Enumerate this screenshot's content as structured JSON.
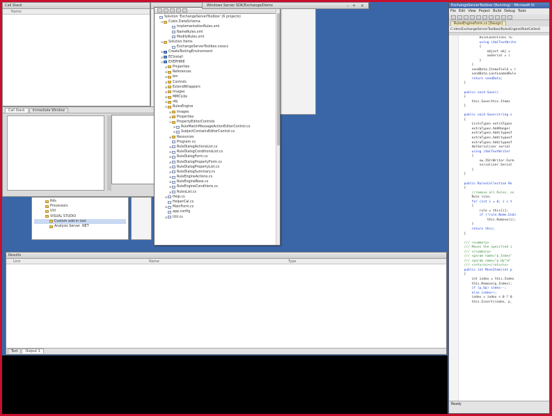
{
  "left_top_panel": {
    "title": "Call Stack",
    "header": "Name"
  },
  "left_mid_panel": {
    "tabs": [
      "Call Stack",
      "Immediate Window"
    ]
  },
  "object_tree": {
    "items": [
      {
        "label": "Rds",
        "indent": 2,
        "kind": "folder"
      },
      {
        "label": "Processors",
        "indent": 2,
        "kind": "folder"
      },
      {
        "label": "Util",
        "indent": 2,
        "kind": "folder"
      },
      {
        "label": "VISUAL STUDIO",
        "indent": 2,
        "kind": "folder"
      },
      {
        "label": "Custom add-in tool",
        "indent": 3,
        "kind": "folder",
        "selected": true
      },
      {
        "label": "Analysis Server .NET",
        "indent": 3,
        "kind": "folder"
      }
    ]
  },
  "solution_explorer": {
    "window_title": "Windows Server SDK/Exchange/Demo",
    "root": "Solution 'ExchangeServerToolbox' (6 projects)",
    "items": [
      {
        "label": "Solution 'ExchangeServerToolbox' (6 projects)",
        "indent": 0,
        "kind": "file",
        "tog": ""
      },
      {
        "label": "Cubic.DataSchema",
        "indent": 1,
        "kind": "folder",
        "tog": "-"
      },
      {
        "label": "ImplementationRules.xml",
        "indent": 3,
        "kind": "file",
        "tog": ""
      },
      {
        "label": "NameRules.xml",
        "indent": 3,
        "kind": "file",
        "tog": ""
      },
      {
        "label": "ModifyRules.xml",
        "indent": 3,
        "kind": "file",
        "tog": ""
      },
      {
        "label": "Solution Items",
        "indent": 1,
        "kind": "folder",
        "tog": "-"
      },
      {
        "label": "ExchangeServerToolbox.vssscc",
        "indent": 3,
        "kind": "file",
        "tog": ""
      },
      {
        "label": "CreateTestingEnvironment",
        "indent": 1,
        "kind": "proj",
        "tog": "+"
      },
      {
        "label": "ECInstall",
        "indent": 1,
        "kind": "proj",
        "tog": "+"
      },
      {
        "label": "EXEPHIRE",
        "indent": 1,
        "kind": "proj",
        "tog": "-"
      },
      {
        "label": "Properties",
        "indent": 2,
        "kind": "folder",
        "tog": "+"
      },
      {
        "label": "References",
        "indent": 2,
        "kind": "folder",
        "tog": "+"
      },
      {
        "label": "bin",
        "indent": 2,
        "kind": "folder",
        "tog": "+"
      },
      {
        "label": "Controls",
        "indent": 2,
        "kind": "folder",
        "tog": "+"
      },
      {
        "label": "ExtendWrappers",
        "indent": 2,
        "kind": "folder",
        "tog": "+"
      },
      {
        "label": "Images",
        "indent": 2,
        "kind": "folder",
        "tog": "+"
      },
      {
        "label": "MMCLibs",
        "indent": 2,
        "kind": "folder",
        "tog": "+"
      },
      {
        "label": "obj",
        "indent": 2,
        "kind": "folder",
        "tog": "+"
      },
      {
        "label": "RulesEngine",
        "indent": 2,
        "kind": "folder",
        "tog": "-"
      },
      {
        "label": "Images",
        "indent": 3,
        "kind": "folder",
        "tog": "+"
      },
      {
        "label": "Properties",
        "indent": 3,
        "kind": "folder",
        "tog": "+"
      },
      {
        "label": "PropertyEditorControls",
        "indent": 3,
        "kind": "folder",
        "tog": "-"
      },
      {
        "label": "RuleMatchMessageActionEditorControl.cs",
        "indent": 4,
        "kind": "file",
        "tog": "+"
      },
      {
        "label": "SubjectContainsEditorControl.cs",
        "indent": 4,
        "kind": "file",
        "tog": "+"
      },
      {
        "label": "Resources",
        "indent": 3,
        "kind": "folder",
        "tog": "+"
      },
      {
        "label": "Program.cs",
        "indent": 3,
        "kind": "file",
        "tog": ""
      },
      {
        "label": "RuleDialogActionsList.cs",
        "indent": 3,
        "kind": "file",
        "tog": "+"
      },
      {
        "label": "RuleDialogConditionsList.cs",
        "indent": 3,
        "kind": "file",
        "tog": "+"
      },
      {
        "label": "RuleDialogForm.cs",
        "indent": 3,
        "kind": "file",
        "tog": "+"
      },
      {
        "label": "RuleDialogPropertyForm.cs",
        "indent": 3,
        "kind": "file",
        "tog": "+"
      },
      {
        "label": "RuleDialogPropertyList.cs",
        "indent": 3,
        "kind": "file",
        "tog": "+"
      },
      {
        "label": "RuleDialogSummary.cs",
        "indent": 3,
        "kind": "file",
        "tog": "+"
      },
      {
        "label": "RuleEngineActions.cs",
        "indent": 3,
        "kind": "file",
        "tog": "+"
      },
      {
        "label": "RuleEngineBase.cs",
        "indent": 3,
        "kind": "file",
        "tog": "+"
      },
      {
        "label": "RuleEngineConditions.cs",
        "indent": 3,
        "kind": "file",
        "tog": "+"
      },
      {
        "label": "RulesList.cs",
        "indent": 3,
        "kind": "file",
        "tog": "+"
      },
      {
        "label": "Help.cs",
        "indent": 2,
        "kind": "file",
        "tog": "+"
      },
      {
        "label": "HelperCal.cs",
        "indent": 2,
        "kind": "file",
        "tog": ""
      },
      {
        "label": "MainForm.cs",
        "indent": 2,
        "kind": "file",
        "tog": "+"
      },
      {
        "label": "app.config",
        "indent": 2,
        "kind": "file",
        "tog": ""
      },
      {
        "label": "Util.cs",
        "indent": 2,
        "kind": "file",
        "tog": "+"
      }
    ]
  },
  "output_panel": {
    "title": "Results",
    "columns": [
      "Line",
      "Name",
      "Type"
    ],
    "tabs": [
      "Test",
      "Output 1"
    ]
  },
  "vs_window": {
    "title": "ExchangeServerToolbox (Running) - Microsoft Vi",
    "menu": [
      "File",
      "Edit",
      "View",
      "Project",
      "Build",
      "Debug",
      "Tools"
    ],
    "doc_tab": "RulesEngineForm.cs [Design]",
    "path": "C:\\dev\\ExchangeServerToolbox\\RulesEngine\\RuleCollecti",
    "status": "Ready",
    "code_lines": [
      {
        "t": "          RuleConditions ru",
        "c": "tx"
      },
      {
        "t": "          using (XmlTextWrite",
        "c": "kw"
      },
      {
        "t": "          {",
        "c": "tx"
      },
      {
        "t": "              object obj = ",
        "c": "tx"
      },
      {
        "t": "              xwSerial = (",
        "c": "tx"
      },
      {
        "t": "          }",
        "c": "tx"
      },
      {
        "t": "      }",
        "c": "tx"
      },
      {
        "t": "      sendData.ItemsField = r",
        "c": "tx"
      },
      {
        "t": "      sendData.LastLoadedRule",
        "c": "tx"
      },
      {
        "t": "      return sendData;",
        "c": "kw"
      },
      {
        "t": "  }",
        "c": "tx"
      },
      {
        "t": "",
        "c": "tx"
      },
      {
        "t": "  public void Save()",
        "c": "kw"
      },
      {
        "t": "  {",
        "c": "tx"
      },
      {
        "t": "      this.Save(this.Items",
        "c": "tx"
      },
      {
        "t": "  }",
        "c": "tx"
      },
      {
        "t": "",
        "c": "tx"
      },
      {
        "t": "  public void Save(string s",
        "c": "kw"
      },
      {
        "t": "  {",
        "c": "tx"
      },
      {
        "t": "      List<Type> extraTypes",
        "c": "tx"
      },
      {
        "t": "      extraTypes.AddRange(",
        "c": "tx"
      },
      {
        "t": "      extraTypes.Add(typeof",
        "c": "tx"
      },
      {
        "t": "      extraTypes.Add(typeof",
        "c": "tx"
      },
      {
        "t": "      extraTypes.Add(typeof",
        "c": "tx"
      },
      {
        "t": "      XmlSerializer serial",
        "c": "tx"
      },
      {
        "t": "      using (XmlTextWriter",
        "c": "kw"
      },
      {
        "t": "      {",
        "c": "tx"
      },
      {
        "t": "          xw.IStrWriter.Form",
        "c": "tx"
      },
      {
        "t": "          serializer.Serial",
        "c": "tx"
      },
      {
        "t": "      }",
        "c": "tx"
      },
      {
        "t": "  }",
        "c": "tx"
      },
      {
        "t": "",
        "c": "tx"
      },
      {
        "t": "  public RulesCollection Re",
        "c": "kw"
      },
      {
        "t": "  {",
        "c": "tx"
      },
      {
        "t": "      //remove all Rules, se",
        "c": "cm"
      },
      {
        "t": "      Rule rule;",
        "c": "tx"
      },
      {
        "t": "      for (int i = 0; i < t",
        "c": "kw"
      },
      {
        "t": "      {",
        "c": "tx"
      },
      {
        "t": "          rule = this[i];",
        "c": "tx"
      },
      {
        "t": "          if (!rule.Name.Ends",
        "c": "kw"
      },
      {
        "t": "              this.Remove(i);",
        "c": "tx"
      },
      {
        "t": "      }",
        "c": "tx"
      },
      {
        "t": "      return this;",
        "c": "kw"
      },
      {
        "t": "  }",
        "c": "tx"
      },
      {
        "t": "",
        "c": "tx"
      },
      {
        "t": "  /// <summary>",
        "c": "cm"
      },
      {
        "t": "  /// Moves the specified i",
        "c": "cm"
      },
      {
        "t": "  /// </summary>",
        "c": "cm"
      },
      {
        "t": "  /// <param name=\"p_Index\"",
        "c": "cm"
      },
      {
        "t": "  /// <param name=\"p_Up\">F",
        "c": "cm"
      },
      {
        "t": "  /// <returns></returns>",
        "c": "cm"
      },
      {
        "t": "  public int MoveItem(int p",
        "c": "kw"
      },
      {
        "t": "  {",
        "c": "tx"
      },
      {
        "t": "      int index = this.Index",
        "c": "tx"
      },
      {
        "t": "      this.Remove(p_Index);",
        "c": "tx"
      },
      {
        "t": "      if (p_Up) index--;",
        "c": "kw"
      },
      {
        "t": "      else index++;",
        "c": "kw"
      },
      {
        "t": "      index = index < 0 ? 0",
        "c": "tx"
      },
      {
        "t": "      this.Insert(index, p_",
        "c": "tx"
      }
    ]
  },
  "colors": {
    "desktop": "#3a66a8",
    "frame": "#c8102e",
    "console": "#000000"
  }
}
